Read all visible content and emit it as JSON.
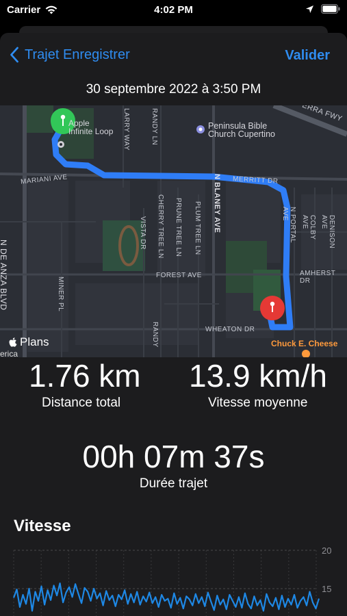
{
  "status_bar": {
    "carrier": "Carrier",
    "time": "4:02 PM"
  },
  "nav": {
    "back_label": "Trajet Enregistrer",
    "action_label": "Valider"
  },
  "trip_date": "30 septembre 2022 à 3:50 PM",
  "map": {
    "credit": "Plans",
    "edge_text": "erica",
    "streets": [
      "N DE ANZA BLVD",
      "MARIANI AVE",
      "LARRY WAY",
      "RANDY LN",
      "N BLANEY AVE",
      "MERRITT DR",
      "N PORTAL AVE",
      "COLBY AVE",
      "DENISON AVE",
      "AMHERST DR",
      "FOREST AVE",
      "WHEATON DR",
      "VISTA DR",
      "CHERRY TREE LN",
      "PRUNE TREE LN",
      "PLUM TREE LN",
      "MINER PL",
      "RANDY",
      "ERRA FWY"
    ],
    "pois": {
      "apple": [
        "Apple",
        "Infinite Loop"
      ],
      "church": [
        "Peninsula Bible",
        "Church Cupertino"
      ],
      "restaurant": "Chuck E. Cheese"
    }
  },
  "stats": {
    "distance_value": "1.76 km",
    "distance_label": "Distance total",
    "speed_value": "13.9 km/h",
    "speed_label": "Vitesse moyenne",
    "duration_value": "00h 07m 37s",
    "duration_label": "Durée trajet"
  },
  "speed_section_title": "Vitesse",
  "chart_data": {
    "type": "line",
    "title": "Vitesse",
    "y_ticks": [
      "20",
      "15"
    ],
    "ylim": [
      10,
      20
    ],
    "values": [
      13.8,
      14.9,
      12.6,
      14.2,
      13.0,
      15.0,
      12.1,
      14.6,
      13.4,
      15.3,
      12.9,
      14.8,
      13.5,
      15.4,
      14.1,
      15.7,
      13.2,
      14.5,
      15.2,
      13.9,
      15.6,
      14.3,
      13.1,
      15.1,
      14.6,
      13.4,
      15.0,
      13.7,
      14.4,
      12.8,
      14.7,
      13.5,
      14.1,
      12.7,
      14.2,
      13.6,
      14.8,
      13.0,
      14.3,
      13.2,
      14.6,
      12.9,
      14.0,
      13.3,
      14.5,
      13.1,
      13.9,
      12.6,
      14.2,
      13.4,
      13.7,
      12.5,
      14.4,
      13.0,
      13.8,
      12.4,
      14.0,
      13.6,
      12.8,
      14.3,
      13.1,
      13.9,
      12.7,
      14.5,
      13.3,
      12.2,
      14.1,
      12.9,
      13.6,
      12.3,
      14.2,
      13.4,
      12.6,
      13.9,
      12.5,
      14.4,
      13.0,
      12.4,
      14.0,
      12.8,
      13.5,
      12.1,
      14.3,
      13.2,
      12.7,
      13.8,
      12.3,
      14.1,
      12.6,
      13.7,
      12.9,
      14.2,
      12.5,
      13.4,
      13.9,
      12.8,
      14.6,
      13.2,
      12.4,
      13.7
    ]
  },
  "colors": {
    "accent": "#2f8cf0",
    "background": "#000000",
    "sheet": "#1c1c1e",
    "route": "#2f7df6",
    "start_pin": "#32c758",
    "end_pin": "#e53935",
    "chart_line": "#1e88e5"
  },
  "icons": {
    "back": "chevron-left-icon",
    "wifi": "wifi-icon",
    "location": "location-arrow-icon",
    "battery": "battery-icon",
    "start": "start-pin-icon",
    "end": "end-pin-icon",
    "apple": "apple-logo-icon"
  }
}
